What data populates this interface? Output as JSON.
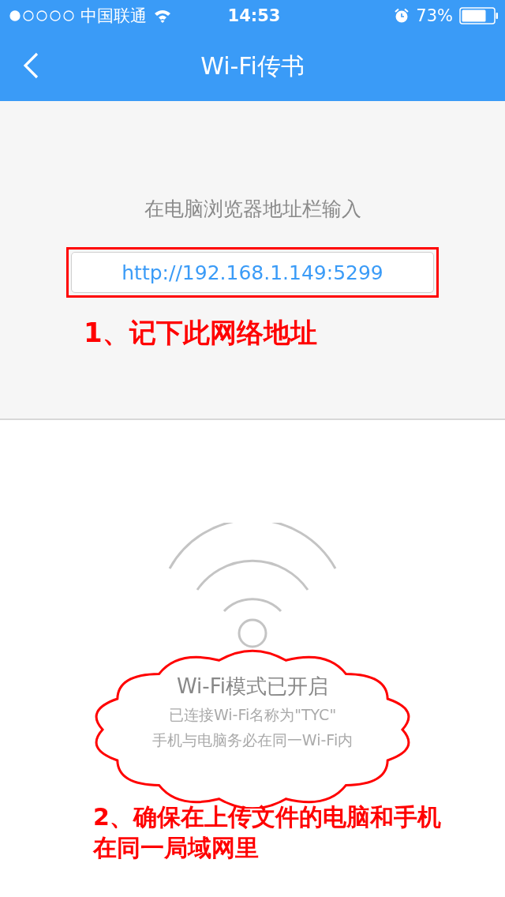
{
  "status_bar": {
    "carrier": "中国联通",
    "time": "14:53",
    "battery": "73%"
  },
  "nav": {
    "title": "Wi-Fi传书"
  },
  "address": {
    "prompt": "在电脑浏览器地址栏输入",
    "url": "http://192.168.1.149:5299",
    "highlighted": true
  },
  "wifi_status": {
    "title": "Wi-Fi模式已开启",
    "lines": [
      "已连接Wi-Fi名称为\"TYC\"",
      "手机与电脑务必在同一Wi-Fi内"
    ],
    "circled": true
  },
  "annotations": [
    {
      "kind": "step",
      "text": "1、记下此网络地址"
    },
    {
      "kind": "step",
      "text": "2、确保在上传文件的电脑和手机在同一局域网里"
    }
  ]
}
